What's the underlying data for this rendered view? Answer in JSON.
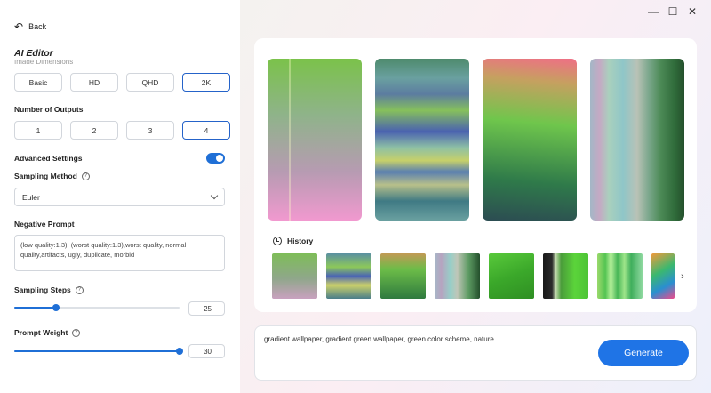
{
  "window": {
    "minimize": "—",
    "maximize": "☐",
    "close": "✕"
  },
  "nav": {
    "back_label": "Back"
  },
  "editor": {
    "title": "AI Editor",
    "image_dimensions_label": "Image Dimensions",
    "dimensions": [
      "Basic",
      "HD",
      "QHD",
      "2K"
    ],
    "dimensions_selected": "2K",
    "outputs_label": "Number of Outputs",
    "outputs": [
      "1",
      "2",
      "3",
      "4"
    ],
    "outputs_selected": "4",
    "advanced_label": "Advanced Settings",
    "advanced_enabled": true,
    "sampling_method_label": "Sampling Method",
    "sampling_method_value": "Euler",
    "negative_prompt_label": "Negative Prompt",
    "negative_prompt_value": "(low quality:1.3), (worst quality:1.3),worst quality, normal quality,artifacts, ugly, duplicate, morbid",
    "sampling_steps_label": "Sampling Steps",
    "sampling_steps_value": "25",
    "sampling_steps_fraction": 0.25,
    "prompt_weight_label": "Prompt Weight",
    "prompt_weight_value": "30",
    "prompt_weight_fraction": 1.0
  },
  "gallery": {
    "history_label": "History"
  },
  "prompt": {
    "text": "gradient wallpaper, gradient green wallpaper, green color scheme, nature",
    "generate_label": "Generate"
  }
}
